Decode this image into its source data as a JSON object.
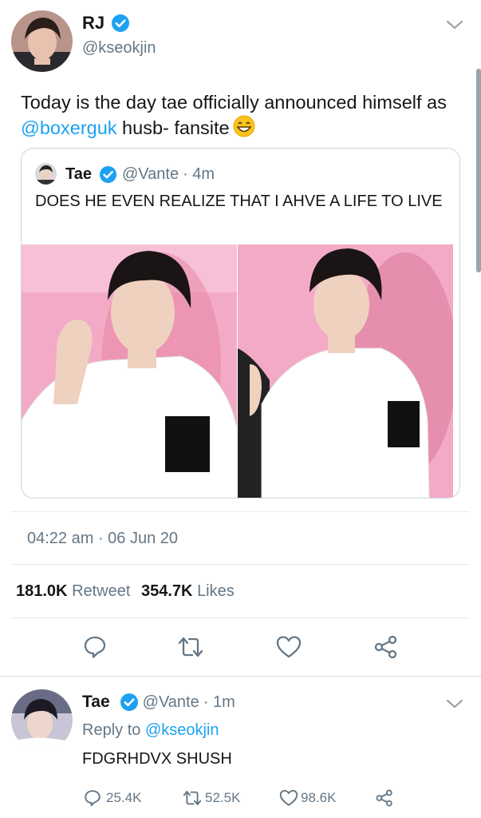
{
  "main_tweet": {
    "author_name": "RJ",
    "author_handle": "@kseokjin",
    "text_before": "Today is the day tae officially announced himself as ",
    "mention": "@boxerguk",
    "text_after": " husb- fansite",
    "emoji": "grinning-face-with-smiling-eyes",
    "quoted": {
      "author_name": "Tae",
      "author_handle": "@Vante",
      "time": "· 4m",
      "text": "DOES HE EVEN REALIZE THAT I AHVE A LIFE TO LIVE"
    },
    "timestamp": "04:22 am · 06 Jun 20",
    "retweets_count": "181.0K",
    "retweets_label": "Retweet",
    "likes_count": "354.7K",
    "likes_label": "Likes"
  },
  "reply": {
    "author_name": "Tae",
    "author_handle": "@Vante",
    "time": "· 1m",
    "reply_to_label": "Reply to",
    "reply_to_handle": "@kseokjin",
    "text": "FDGRHDVX SHUSH",
    "replies": "25.4K",
    "retweets": "52.5K",
    "likes": "98.6K"
  },
  "colors": {
    "accent": "#1da1f2",
    "secondary_text": "#657786",
    "pink_backdrop": "#f2a6c8"
  }
}
